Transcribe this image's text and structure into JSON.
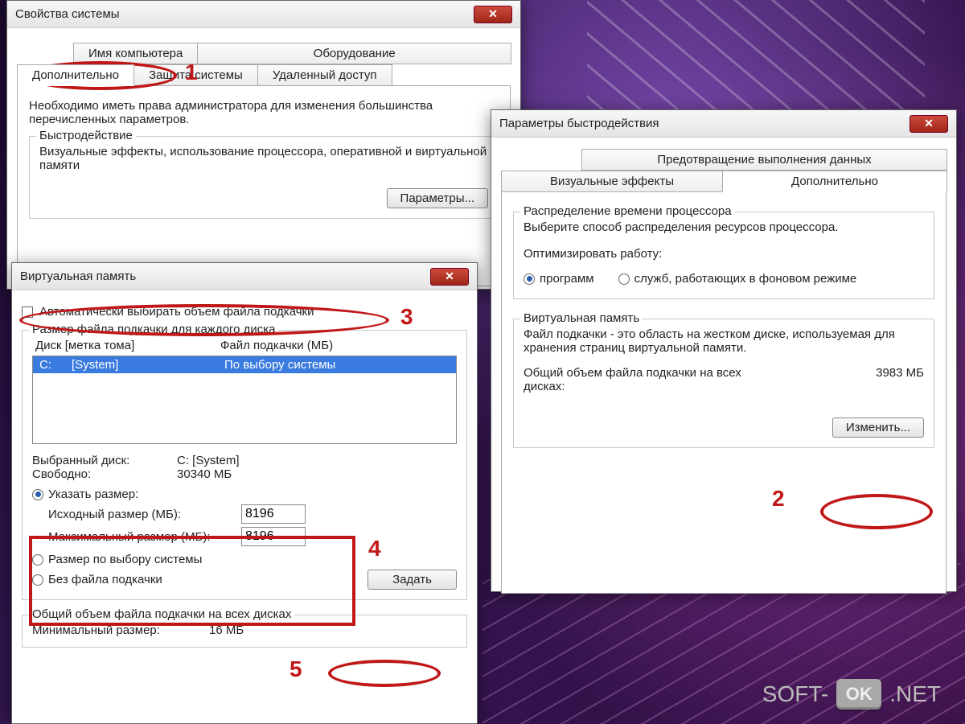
{
  "window1": {
    "title": "Свойства системы",
    "tabs_row1": [
      "Имя компьютера",
      "Оборудование"
    ],
    "tabs_row2": [
      "Дополнительно",
      "Защита системы",
      "Удаленный доступ"
    ],
    "active_tab": "Дополнительно",
    "admin_note": "Необходимо иметь права администратора для изменения большинства перечисленных параметров.",
    "perf_group": {
      "title": "Быстродействие",
      "desc": "Визуальные эффекты, использование процессора, оперативной и виртуальной памяти",
      "button": "Параметры..."
    }
  },
  "window2": {
    "title": "Параметры быстродействия",
    "tabs_row1": [
      "Предотвращение выполнения данных"
    ],
    "tabs_row2": [
      "Визуальные эффекты",
      "Дополнительно"
    ],
    "active_tab": "Дополнительно",
    "cpu_group": {
      "title": "Распределение времени процессора",
      "desc": "Выберите способ распределения ресурсов процессора.",
      "optimize_label": "Оптимизировать работу:",
      "opt_programs": "программ",
      "opt_services": "служб, работающих в фоновом режиме"
    },
    "vm_group": {
      "title": "Виртуальная память",
      "desc": "Файл подкачки - это область на жестком диске, используемая для хранения страниц виртуальной памяти.",
      "total_label": "Общий объем файла подкачки на всех дисках:",
      "total_value": "3983 МБ",
      "change_btn": "Изменить..."
    }
  },
  "window3": {
    "title": "Виртуальная память",
    "auto_checkbox": "Автоматически выбирать объем файла подкачки",
    "size_group_title": "Размер файла подкачки для каждого диска",
    "list_header_drive": "Диск [метка тома]",
    "list_header_file": "Файл подкачки (МБ)",
    "list_row_drive": "C:      [System]",
    "list_row_file": "По выбору системы",
    "selected_drive_label": "Выбранный диск:",
    "selected_drive_value": "C:  [System]",
    "free_label": "Свободно:",
    "free_value": "30340 МБ",
    "custom_radio": "Указать размер:",
    "init_label": "Исходный размер (МБ):",
    "init_value": "8196",
    "max_label": "Максимальный размер (МБ):",
    "max_value": "8196",
    "system_radio": "Размер по выбору системы",
    "none_radio": "Без файла подкачки",
    "set_btn": "Задать",
    "total_title": "Общий объем файла подкачки на всех дисках",
    "min_label": "Минимальный размер:",
    "min_value": "16 МБ"
  },
  "annotations": {
    "n1": "1",
    "n2": "2",
    "n3": "3",
    "n4": "4",
    "n5": "5"
  },
  "watermark": {
    "left": "SOFT-",
    "mid": "OK",
    "right": ".NET"
  }
}
